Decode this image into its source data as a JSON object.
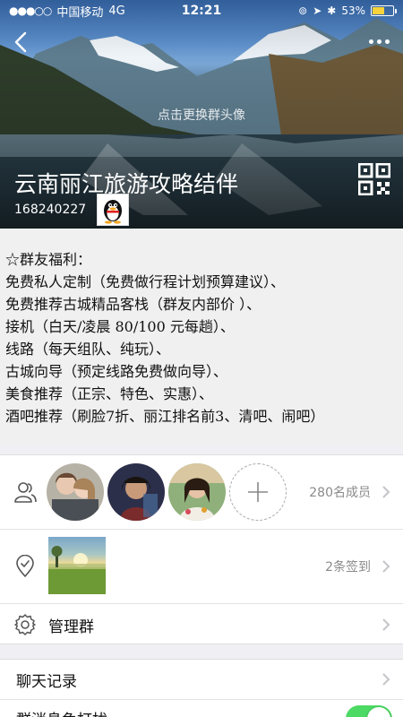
{
  "statusbar": {
    "carrier": "中国移动",
    "network": "4G",
    "time": "12:21",
    "battery": "53%",
    "battery_level": 0.53
  },
  "header": {
    "change_avatar_hint": "点击更换群头像",
    "group_name": "云南丽江旅游攻略结伴",
    "group_id": "168240227"
  },
  "notice": {
    "lines": [
      "☆群友福利：",
      "免费私人定制（免费做行程计划预算建议）、",
      "免费推荐古城精品客栈（群友内部价 ）、",
      "接机（白天/凌晨 80/100 元每趟）、",
      "线路（每天组队、纯玩）、",
      "古城向导（预定线路免费做向导）、",
      "美食推荐（正宗、特色、实惠）、",
      "酒吧推荐（刷脸7折、丽江排名前3、清吧、闹吧）"
    ]
  },
  "members": {
    "count_label": "280名成员"
  },
  "signin": {
    "count_label": "2条签到"
  },
  "manage": {
    "label": "管理群"
  },
  "chat_history": {
    "label": "聊天记录"
  },
  "notify": {
    "label": "群消息免打扰",
    "enabled": true
  },
  "colors": {
    "toggle_on": "#4cd964",
    "battery": "#f7d23b"
  }
}
